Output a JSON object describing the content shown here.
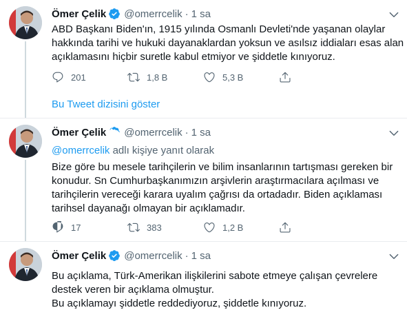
{
  "colors": {
    "link": "#1d9bf0",
    "muted": "#536471",
    "text": "#0f1419",
    "verified": "#1d9bf0"
  },
  "tweets": [
    {
      "name": "Ömer Çelik",
      "handle": "@omerrcelik",
      "separator": "·",
      "time": "1 sa",
      "lines": [
        "ABD Başkanı Biden'ın, 1915 yılında Osmanlı Devleti'nde yaşanan olaylar",
        "hakkında tarihi ve hukuki dayanaklardan yoksun ve asılsız iddiaları esas alan",
        "açıklamasını hiçbir suretle kabul etmiyor ve şiddetle kınıyoruz."
      ],
      "replies": "201",
      "retweets": "1,8 B",
      "likes": "5,3 B",
      "show_thread": "Bu Tweet dizisini göster"
    },
    {
      "name": "Ömer Çelik",
      "handle": "@omerrcelik",
      "separator": "·",
      "time": "1 sa",
      "reply_mention": "@omerrcelik",
      "reply_suffix": " adlı kişiye yanıt olarak",
      "lines": [
        "Bize göre bu mesele tarihçilerin ve bilim insanlarının tartışması gereken bir",
        "konudur. Sn Cumhurbaşkanımızın arşivlerin araştırmacılara açılması ve",
        "tarihçilerin vereceği karara uyalım çağrısı da ortadadır. Biden açıklaması",
        "tarihsel dayanağı olmayan bir açıklamadır."
      ],
      "replies": "17",
      "retweets": "383",
      "likes": "1,2 B"
    },
    {
      "name": "Ömer Çelik",
      "handle": "@omerrcelik",
      "separator": "·",
      "time": "1 sa",
      "lines": [
        "Bu açıklama, Türk-Amerikan ilişkilerini sabote etmeye çalışan çevrelere",
        "destek veren bir açıklama olmuştur.",
        "Bu açıklamayı şiddetle reddediyoruz, şiddetle kınıyoruz."
      ]
    }
  ]
}
